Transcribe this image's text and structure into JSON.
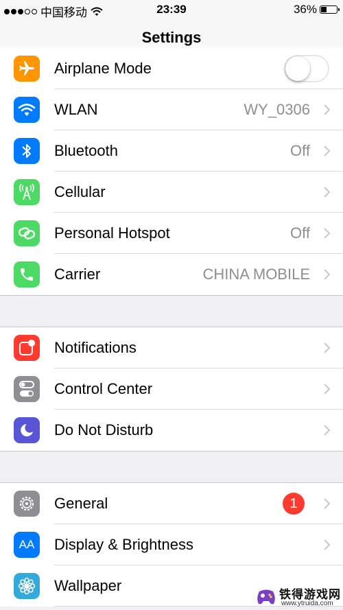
{
  "status_bar": {
    "carrier": "中国移动",
    "time": "23:39",
    "battery": "36%",
    "battery_level": 0.36
  },
  "nav": {
    "title": "Settings"
  },
  "groups": [
    {
      "rows": [
        {
          "label": "Airplane Mode",
          "icon": "airplane-icon",
          "color": "#ff9500",
          "control": "toggle",
          "toggle_on": false
        },
        {
          "label": "WLAN",
          "value": "WY_0306",
          "icon": "wifi-icon",
          "color": "#007aff"
        },
        {
          "label": "Bluetooth",
          "value": "Off",
          "icon": "bluetooth-icon",
          "color": "#007aff"
        },
        {
          "label": "Cellular",
          "value": "",
          "icon": "cellular-icon",
          "color": "#4cd964"
        },
        {
          "label": "Personal Hotspot",
          "value": "Off",
          "icon": "hotspot-icon",
          "color": "#4cd964"
        },
        {
          "label": "Carrier",
          "value": "CHINA MOBILE",
          "icon": "phone-icon",
          "color": "#4cd964"
        }
      ]
    },
    {
      "rows": [
        {
          "label": "Notifications",
          "icon": "notifications-icon",
          "color": "#ff3b30"
        },
        {
          "label": "Control Center",
          "icon": "control-center-icon",
          "color": "#8e8e93"
        },
        {
          "label": "Do Not Disturb",
          "icon": "moon-icon",
          "color": "#5856d6"
        }
      ]
    },
    {
      "rows": [
        {
          "label": "General",
          "badge": "1",
          "icon": "gear-icon",
          "color": "#8e8e93"
        },
        {
          "label": "Display & Brightness",
          "icon": "text-size-icon",
          "color": "#007aff",
          "icon_text": "AA"
        },
        {
          "label": "Wallpaper",
          "icon": "flower-icon",
          "color": "#34aadc"
        }
      ]
    }
  ],
  "watermark": {
    "title": "铁得游戏网",
    "url": "www.ytruida.com"
  }
}
